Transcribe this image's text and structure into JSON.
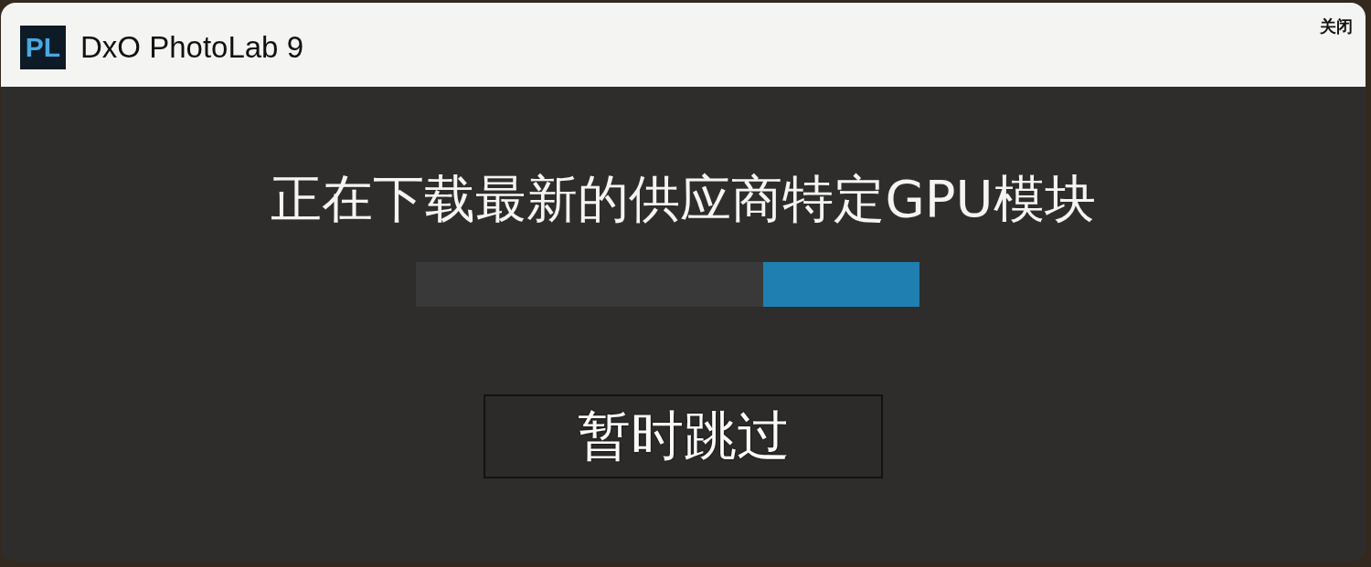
{
  "window": {
    "app_logo": "PL",
    "title": "DxO PhotoLab 9",
    "close_label": "关闭"
  },
  "message": "正在下载最新的供应商特定GPU模块",
  "progress": {
    "level": 0.31
  },
  "buttons": [
    {
      "label": "暂时跳过"
    }
  ]
}
